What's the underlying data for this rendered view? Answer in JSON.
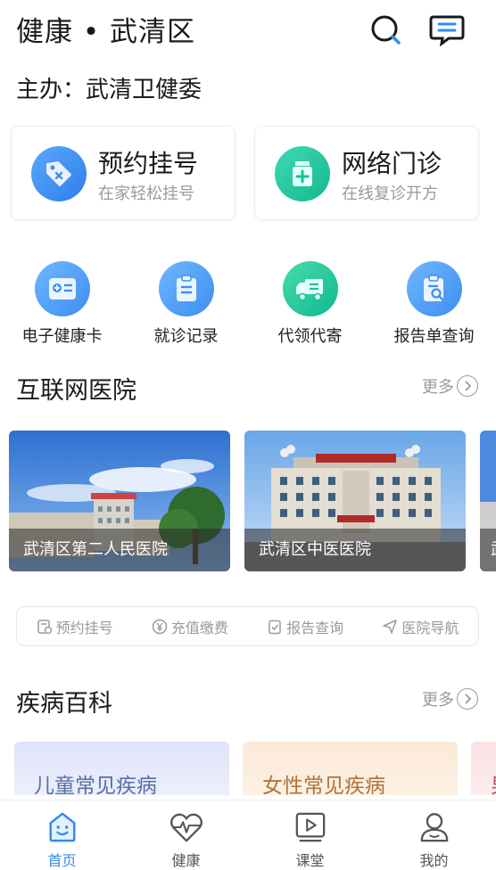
{
  "header": {
    "title": "健康 • 武清区",
    "organizer": "主办：武清卫健委",
    "icons": [
      "search-icon",
      "message-icon"
    ]
  },
  "feature_cards": [
    {
      "title": "预约挂号",
      "subtitle": "在家轻松挂号",
      "icon": "tag-icon",
      "color": "#3f8ef0"
    },
    {
      "title": "网络门诊",
      "subtitle": "在线复诊开方",
      "icon": "medicine-bottle-icon",
      "color": "#18c3a0"
    }
  ],
  "quick_actions": [
    {
      "label": "电子健康卡",
      "icon": "health-card-icon",
      "color": "#4a9ff5"
    },
    {
      "label": "就诊记录",
      "icon": "clipboard-icon",
      "color": "#4a9ff5"
    },
    {
      "label": "代领代寄",
      "icon": "delivery-truck-icon",
      "color": "#1fc79a"
    },
    {
      "label": "报告单查询",
      "icon": "report-search-icon",
      "color": "#4a9ff5"
    }
  ],
  "internet_hospital": {
    "title": "互联网医院",
    "more": "更多",
    "hospitals": [
      {
        "name": "武清区第二人民医院"
      },
      {
        "name": "武清区中医医院"
      },
      {
        "name": "武"
      }
    ]
  },
  "services": [
    {
      "label": "预约挂号",
      "icon": "register-icon"
    },
    {
      "label": "充值缴费",
      "icon": "yen-icon"
    },
    {
      "label": "报告查询",
      "icon": "report-check-icon"
    },
    {
      "label": "医院导航",
      "icon": "navigation-icon"
    }
  ],
  "disease_encyclopedia": {
    "title": "疾病百科",
    "more": "更多",
    "cards": [
      {
        "label": "儿童常见疾病"
      },
      {
        "label": "女性常见疾病"
      },
      {
        "label": "男"
      }
    ]
  },
  "bottom_nav": [
    {
      "label": "首页",
      "icon": "home-smile-icon",
      "active": true
    },
    {
      "label": "健康",
      "icon": "heartbeat-icon",
      "active": false
    },
    {
      "label": "课堂",
      "icon": "video-play-icon",
      "active": false
    },
    {
      "label": "我的",
      "icon": "user-icon",
      "active": false
    }
  ]
}
